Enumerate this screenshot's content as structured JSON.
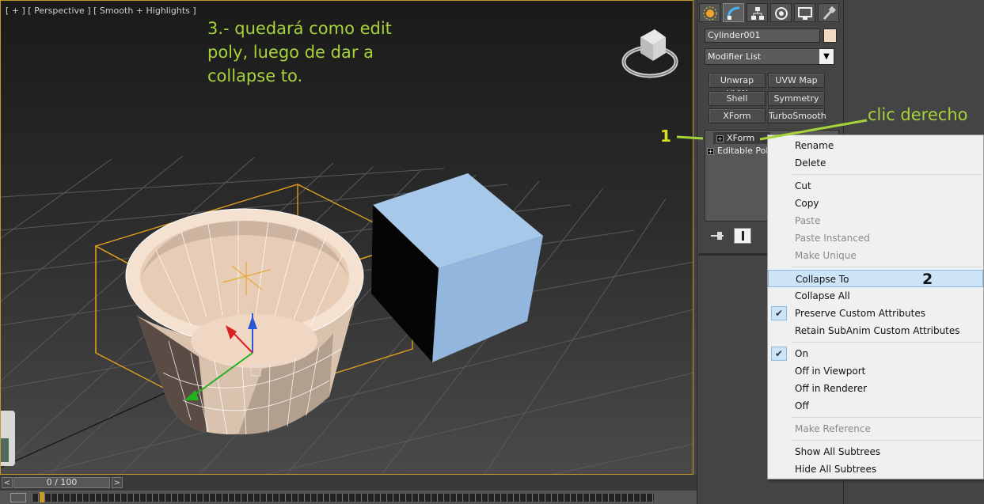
{
  "viewport": {
    "label": "[ + ] [ Perspective ] [ Smooth + Highlights ]",
    "annotation_lines": [
      "3.- quedará como edit",
      "poly, luego de dar a",
      "collapse to."
    ]
  },
  "timeline": {
    "prev": "<",
    "next": ">",
    "frame": "0 / 100"
  },
  "panel": {
    "tabs": [
      "create-icon",
      "modify-icon",
      "hierarchy-icon",
      "motion-icon",
      "display-icon",
      "utilities-icon"
    ],
    "object_name": "Cylinder001",
    "object_color": "#f1d9c4",
    "modifier_list": "Modifier List",
    "modifier_buttons": [
      "Unwrap UVW",
      "UVW Map",
      "Shell",
      "Symmetry",
      "XForm",
      "TurboSmooth"
    ],
    "stack": [
      {
        "label": "XForm"
      },
      {
        "label": "Editable Poly"
      }
    ]
  },
  "callouts": {
    "right_click": "clic derecho",
    "step1": "1",
    "step2": "2"
  },
  "context_menu": {
    "items": [
      {
        "label": "Rename",
        "state": "normal"
      },
      {
        "label": "Delete",
        "state": "normal"
      },
      {
        "label": "Cut",
        "state": "normal"
      },
      {
        "label": "Copy",
        "state": "normal"
      },
      {
        "label": "Paste",
        "state": "disabled"
      },
      {
        "label": "Paste Instanced",
        "state": "disabled"
      },
      {
        "label": "Make Unique",
        "state": "disabled"
      },
      {
        "label": "Collapse To",
        "state": "highlighted"
      },
      {
        "label": "Collapse All",
        "state": "normal"
      },
      {
        "label": "Preserve Custom Attributes",
        "state": "checked"
      },
      {
        "label": "Retain SubAnim Custom Attributes",
        "state": "normal"
      },
      {
        "label": "On",
        "state": "checked"
      },
      {
        "label": "Off in Viewport",
        "state": "normal"
      },
      {
        "label": "Off in Renderer",
        "state": "normal"
      },
      {
        "label": "Off",
        "state": "normal"
      },
      {
        "label": "Make Reference",
        "state": "disabled"
      },
      {
        "label": "Show All Subtrees",
        "state": "normal"
      },
      {
        "label": "Hide All Subtrees",
        "state": "normal"
      }
    ],
    "check_glyph": "✔"
  },
  "colors": {
    "annotation": "#a6d33a",
    "selection_bracket": "#e8a21a",
    "box_face": "#94b7e0",
    "cylinder": "#f1d9c4"
  }
}
